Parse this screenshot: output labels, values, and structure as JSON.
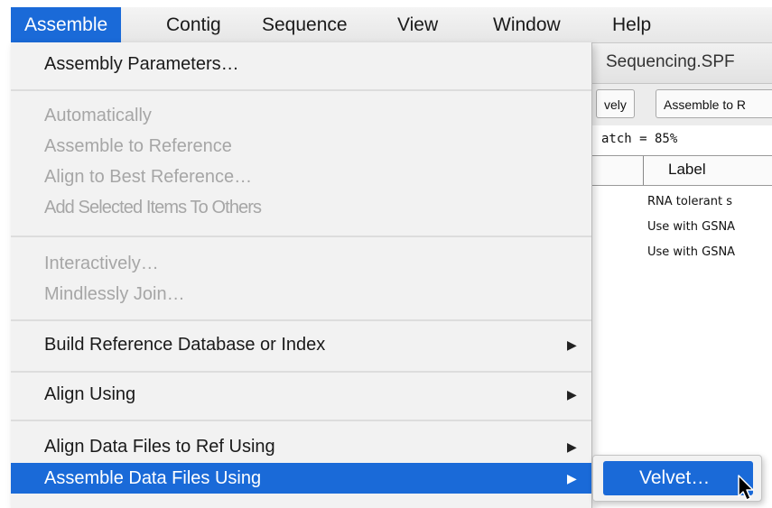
{
  "menubar": {
    "items": [
      "Assemble",
      "Contig",
      "Sequence",
      "View",
      "Window",
      "Help"
    ],
    "active": "Assemble"
  },
  "background_window": {
    "title": "Sequencing.SPF",
    "buttons": [
      "vely",
      "Assemble to R"
    ],
    "info": "atch = 85%",
    "column_label": "Label",
    "rows": [
      "RNA tolerant s",
      "Use with GSNA",
      "Use with GSNA"
    ]
  },
  "menu": {
    "items": [
      {
        "label": "Assembly Parameters…",
        "enabled": true
      },
      {
        "label": "Automatically",
        "enabled": false
      },
      {
        "label": "Assemble to Reference",
        "enabled": false
      },
      {
        "label": "Align to Best Reference…",
        "enabled": false
      },
      {
        "label": "Add Selected Items To Others",
        "enabled": false
      },
      {
        "label": "Interactively…",
        "enabled": false
      },
      {
        "label": "Mindlessly Join…",
        "enabled": false
      },
      {
        "label": "Build Reference Database or Index",
        "enabled": true,
        "submenu": true
      },
      {
        "label": "Align Using",
        "enabled": true,
        "submenu": true
      },
      {
        "label": "Align Data Files to Ref Using",
        "enabled": true,
        "submenu": true
      },
      {
        "label": "Assemble Data Files Using",
        "enabled": true,
        "submenu": true,
        "highlighted": true
      }
    ],
    "submenu_arrow": "▶"
  },
  "submenu": {
    "items": [
      "Velvet…"
    ],
    "highlighted": "Velvet…"
  },
  "colors": {
    "highlight": "#1a6ad8",
    "disabled_text": "#a6a6a6",
    "menu_bg": "#f2f2f2"
  }
}
